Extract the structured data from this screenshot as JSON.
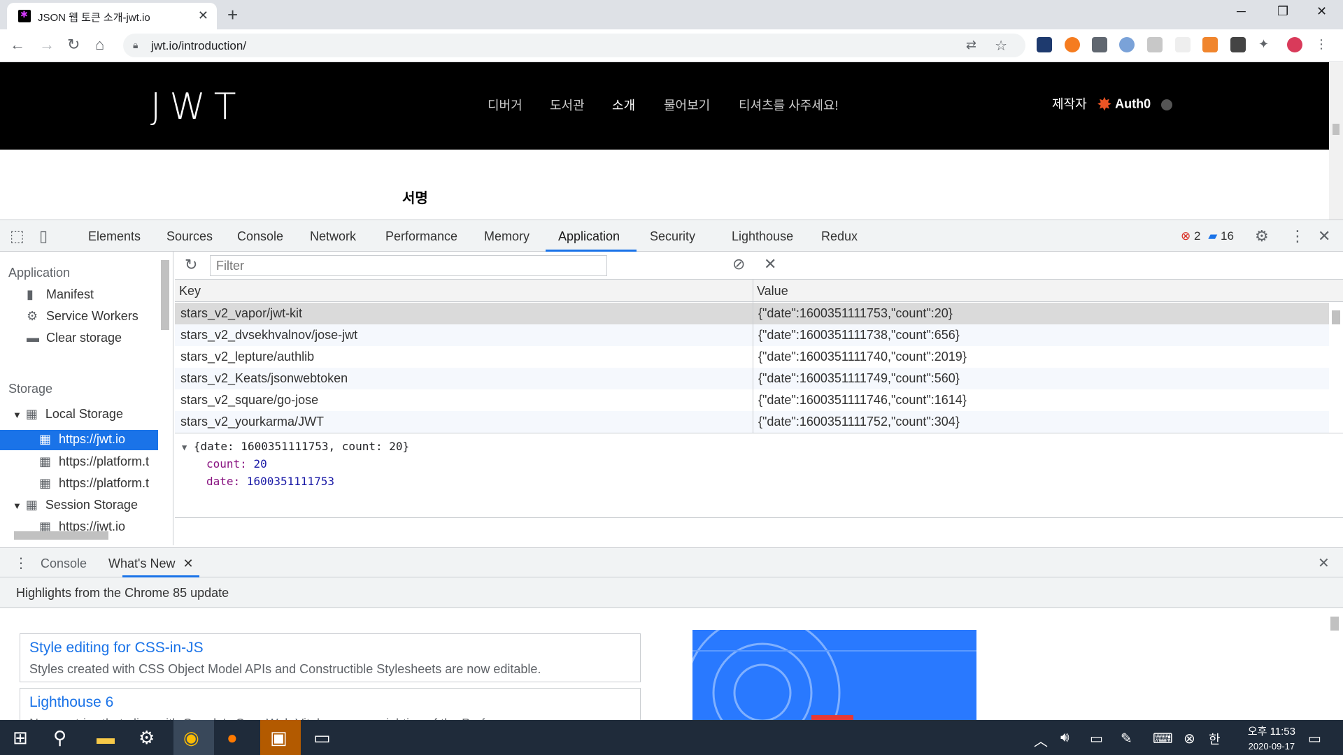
{
  "browser": {
    "tab_title": "JSON 웹 토큰 소개-jwt.io",
    "url": "jwt.io/introduction/"
  },
  "site": {
    "logo": "JWT",
    "nav": [
      "디버거",
      "도서관",
      "소개",
      "물어보기",
      "티셔츠를 사주세요!"
    ],
    "active_nav": "소개",
    "made_by": "제작자",
    "brand": "Auth0",
    "section_heading": "서명"
  },
  "devtools": {
    "tabs": [
      "Elements",
      "Sources",
      "Console",
      "Network",
      "Performance",
      "Memory",
      "Application",
      "Security",
      "Lighthouse",
      "Redux"
    ],
    "active_tab": "Application",
    "error_count": "2",
    "message_count": "16",
    "sidebar": {
      "application_heading": "Application",
      "application_items": [
        "Manifest",
        "Service Workers",
        "Clear storage"
      ],
      "storage_heading": "Storage",
      "local_storage": "Local Storage",
      "local_origins": [
        "https://jwt.io",
        "https://platform.t",
        "https://platform.t"
      ],
      "session_storage": "Session Storage",
      "session_origins": [
        "https://jwt.io"
      ]
    },
    "filter_placeholder": "Filter",
    "columns": {
      "key": "Key",
      "value": "Value"
    },
    "rows": [
      {
        "key": "stars_v2_vapor/jwt-kit",
        "value": "{\"date\":1600351111753,\"count\":20}"
      },
      {
        "key": "stars_v2_dvsekhvalnov/jose-jwt",
        "value": "{\"date\":1600351111738,\"count\":656}"
      },
      {
        "key": "stars_v2_lepture/authlib",
        "value": "{\"date\":1600351111740,\"count\":2019}"
      },
      {
        "key": "stars_v2_Keats/jsonwebtoken",
        "value": "{\"date\":1600351111749,\"count\":560}"
      },
      {
        "key": "stars_v2_square/go-jose",
        "value": "{\"date\":1600351111746,\"count\":1614}"
      },
      {
        "key": "stars_v2_yourkarma/JWT",
        "value": "{\"date\":1600351111752,\"count\":304}"
      }
    ],
    "preview": {
      "summary": "{date: 1600351111753, count: 20}",
      "count_label": "count:",
      "count_value": "20",
      "date_label": "date:",
      "date_value": "1600351111753"
    },
    "drawer": {
      "tabs": [
        "Console",
        "What's New"
      ],
      "heading": "Highlights from the Chrome 85 update",
      "cards": [
        {
          "title": "Style editing for CSS-in-JS",
          "desc": "Styles created with CSS Object Model APIs and Constructible Stylesheets are now editable."
        },
        {
          "title": "Lighthouse 6",
          "desc": "New metrics that align with Google's Core Web Vitals, a new weighting of the Performance"
        }
      ]
    }
  },
  "taskbar": {
    "ime": "한",
    "time": "오후 11:53",
    "date": "2020-09-17"
  }
}
